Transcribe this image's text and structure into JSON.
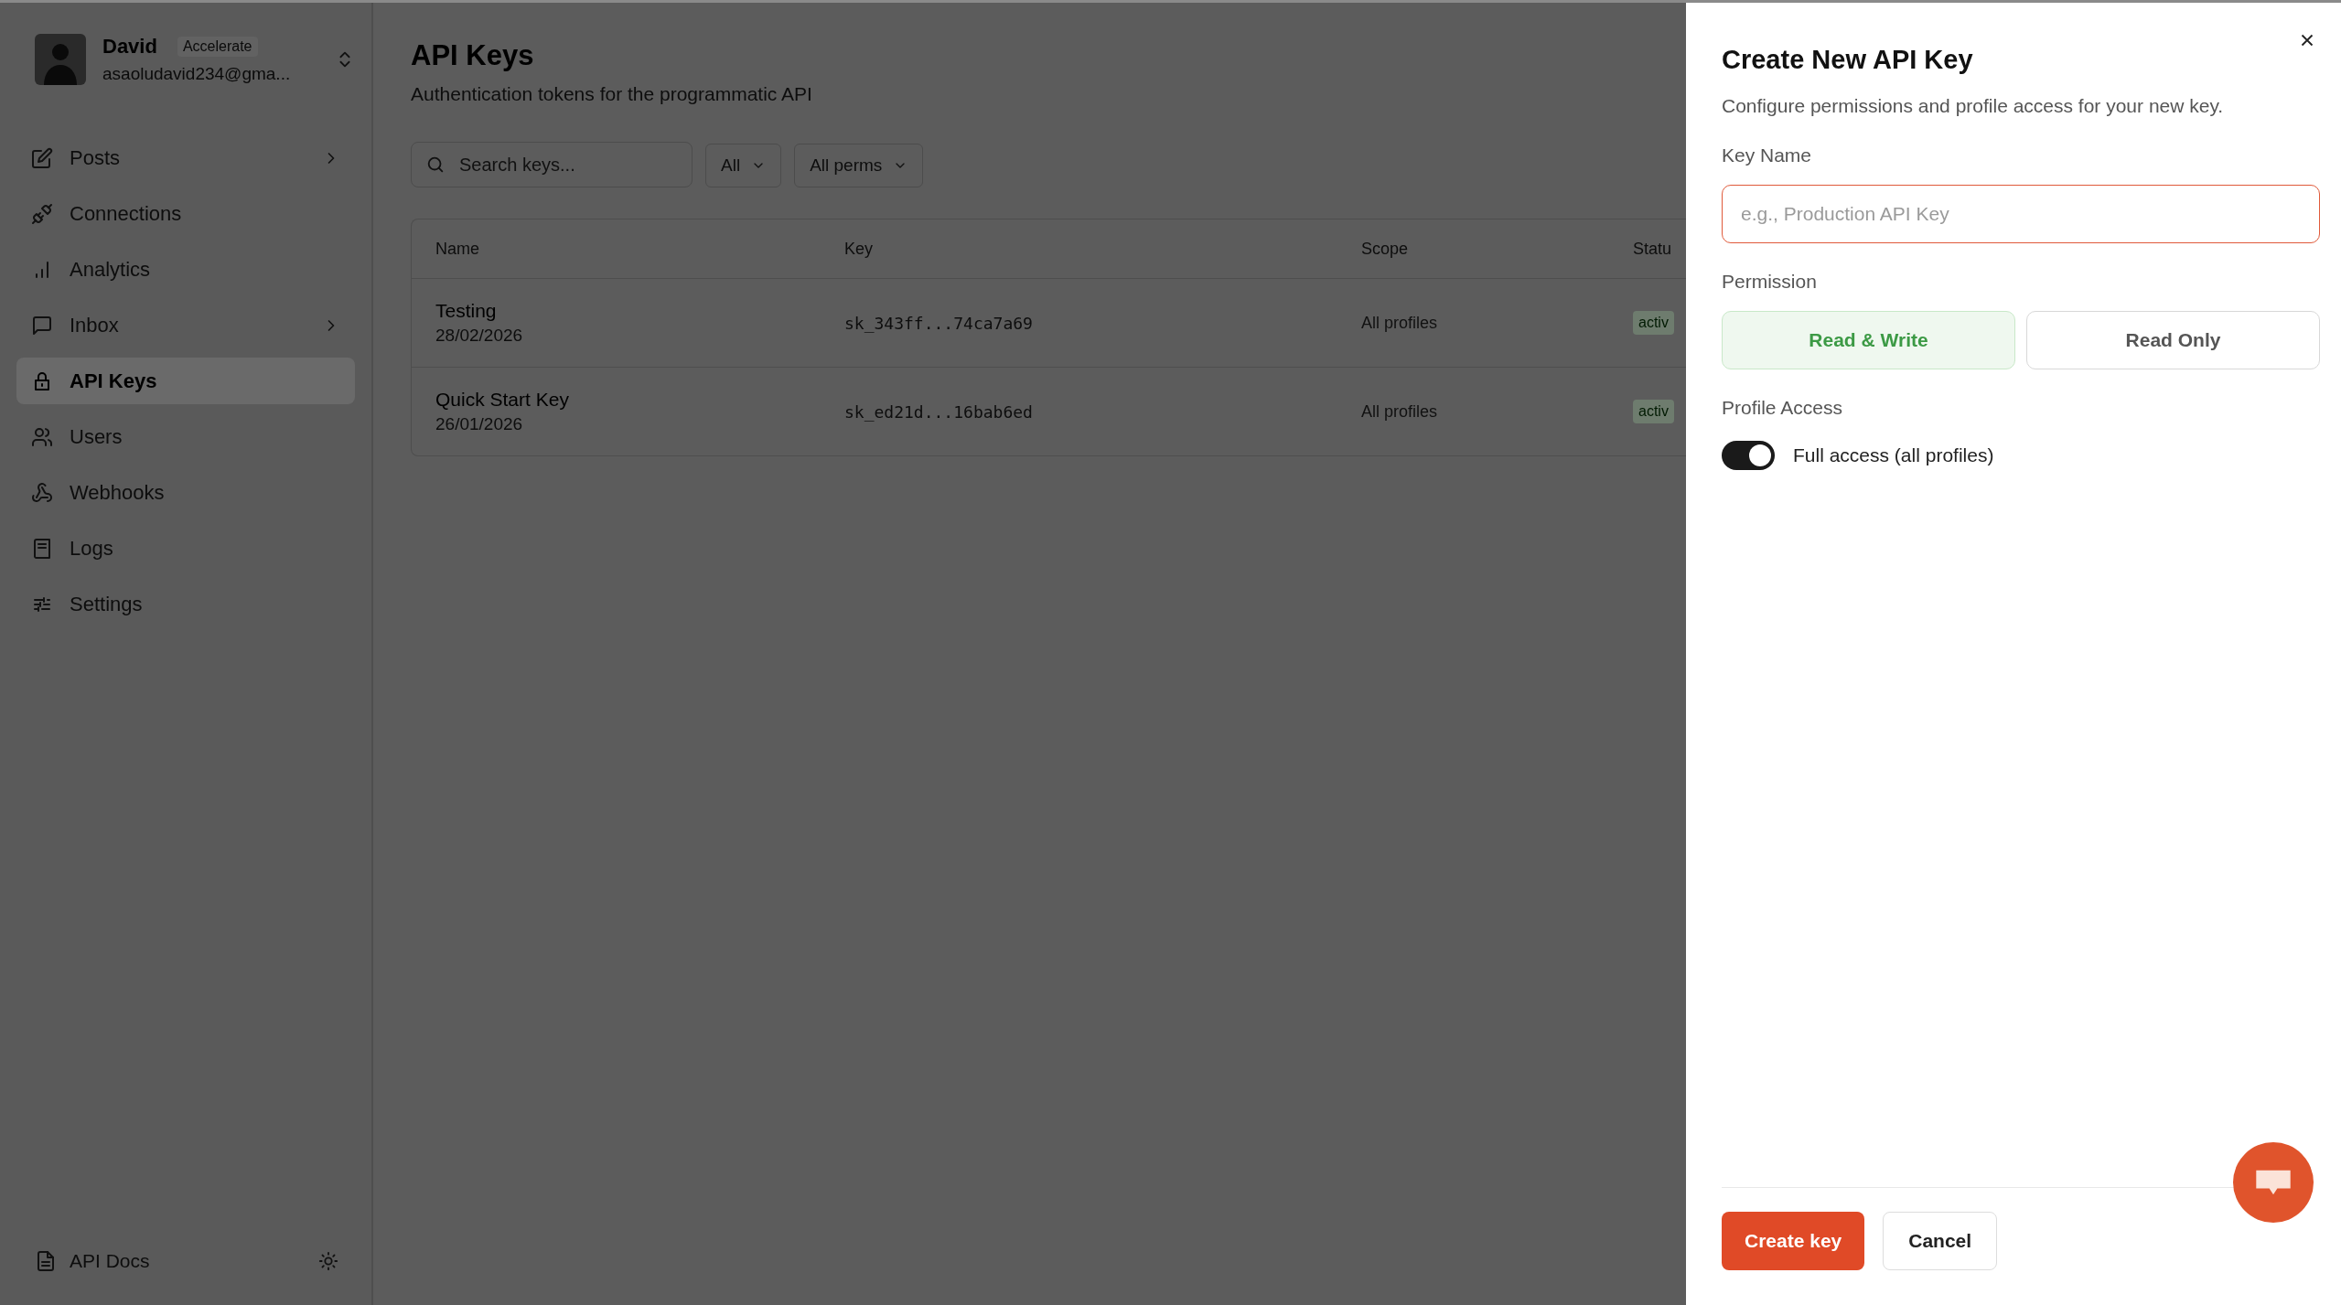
{
  "user": {
    "name": "David",
    "plan": "Accelerate",
    "email": "asaoludavid234@gma..."
  },
  "sidebar": {
    "items": [
      {
        "label": "Posts",
        "expandable": true,
        "selected": false
      },
      {
        "label": "Connections",
        "expandable": false,
        "selected": false
      },
      {
        "label": "Analytics",
        "expandable": false,
        "selected": false
      },
      {
        "label": "Inbox",
        "expandable": true,
        "selected": false
      },
      {
        "label": "API Keys",
        "expandable": false,
        "selected": true
      },
      {
        "label": "Users",
        "expandable": false,
        "selected": false
      },
      {
        "label": "Webhooks",
        "expandable": false,
        "selected": false
      },
      {
        "label": "Logs",
        "expandable": false,
        "selected": false
      },
      {
        "label": "Settings",
        "expandable": false,
        "selected": false
      }
    ],
    "footer_link": "API Docs"
  },
  "page": {
    "title": "API Keys",
    "subtitle": "Authentication tokens for the programmatic API",
    "search": {
      "placeholder": "Search keys..."
    },
    "filters": [
      "All",
      "All perms"
    ]
  },
  "table": {
    "columns": [
      "Name",
      "Key",
      "Scope",
      "Statu"
    ],
    "rows": [
      {
        "name": "Testing",
        "date": "28/02/2026",
        "key": "sk_343ff...74ca7a69",
        "scope": "All profiles",
        "status": "activ"
      },
      {
        "name": "Quick Start Key",
        "date": "26/01/2026",
        "key": "sk_ed21d...16bab6ed",
        "scope": "All profiles",
        "status": "activ"
      }
    ]
  },
  "dialog": {
    "title": "Create New API Key",
    "description": "Configure permissions and profile access for your new key.",
    "key_name": {
      "label": "Key Name",
      "placeholder": "e.g., Production API Key"
    },
    "permission": {
      "label": "Permission",
      "options": [
        {
          "label": "Read & Write",
          "selected": true
        },
        {
          "label": "Read Only",
          "selected": false
        }
      ]
    },
    "profile_access": {
      "label": "Profile Access",
      "toggle": {
        "label": "Full access (all profiles)",
        "on": true
      }
    },
    "buttons": {
      "primary": "Create key",
      "secondary": "Cancel"
    }
  }
}
